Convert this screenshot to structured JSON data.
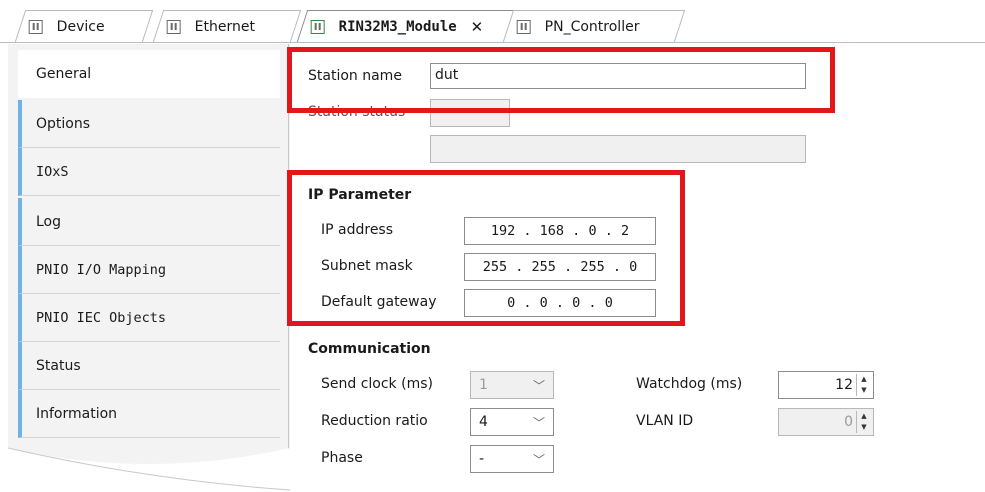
{
  "tabs": [
    {
      "label": "Device",
      "icon": "device-icon"
    },
    {
      "label": "Ethernet",
      "icon": "device-icon"
    },
    {
      "label": "RIN32M3_Module",
      "icon": "module-icon",
      "active": true
    },
    {
      "label": "PN_Controller",
      "icon": "device-icon"
    }
  ],
  "nav": {
    "items": [
      "General",
      "Options",
      "IOxS",
      "Log",
      "PNIO I/O Mapping",
      "PNIO IEC Objects",
      "Status",
      "Information"
    ]
  },
  "general": {
    "station_name_label": "Station name",
    "station_name_value": "dut",
    "station_status_label": "Station status",
    "station_status_value": "",
    "status_text": ""
  },
  "ip": {
    "header": "IP Parameter",
    "ip_label": "IP address",
    "ip_value": "192 . 168 . 0 . 2",
    "subnet_label": "Subnet mask",
    "subnet_value": "255 . 255 . 255 . 0",
    "gateway_label": "Default gateway",
    "gateway_value": "0 . 0 . 0 . 0"
  },
  "comm": {
    "header": "Communication",
    "send_clock_label": "Send clock (ms)",
    "send_clock_value": "1",
    "reduction_label": "Reduction ratio",
    "reduction_value": "4",
    "phase_label": "Phase",
    "phase_value": "-",
    "watchdog_label": "Watchdog (ms)",
    "watchdog_value": "12",
    "vlan_label": "VLAN ID",
    "vlan_value": "0"
  },
  "colors": {
    "highlight": "#e3161b",
    "nav_accent": "#6fb3e6"
  }
}
